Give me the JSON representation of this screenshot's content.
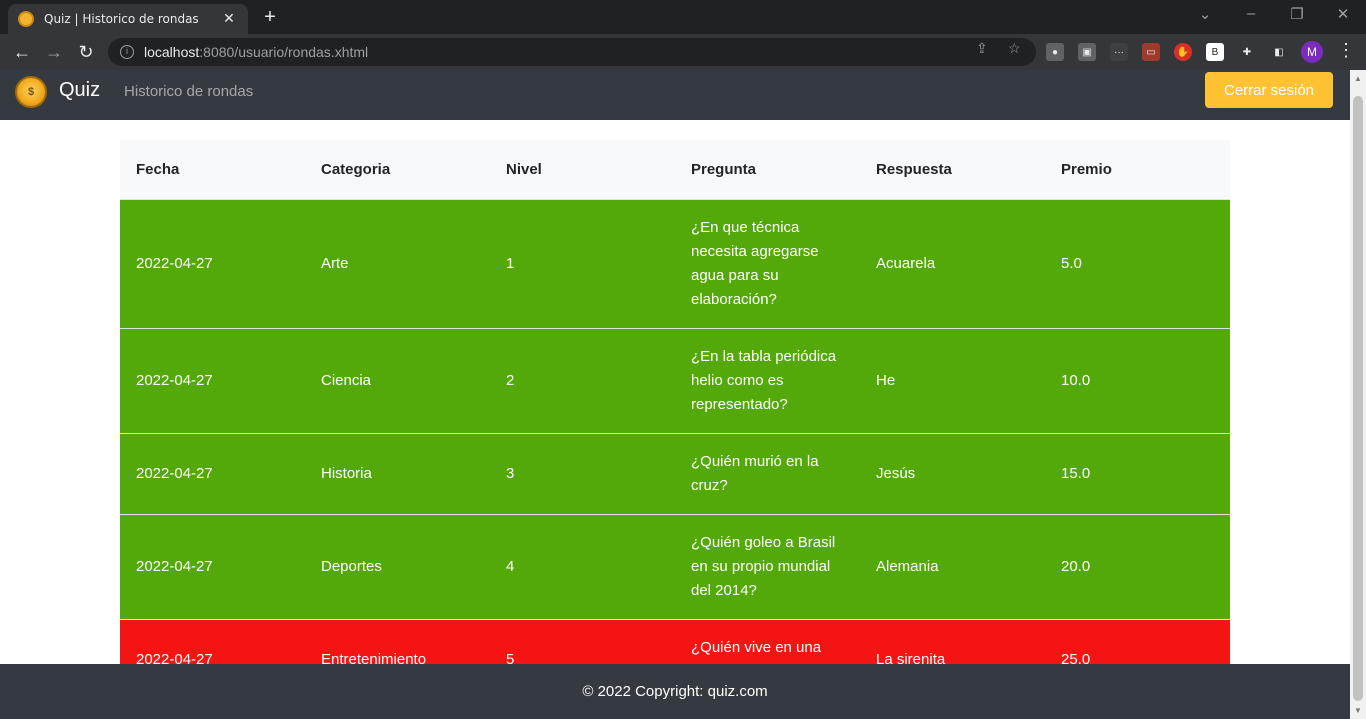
{
  "browser": {
    "tab_title": "Quiz | Historico de rondas",
    "url_host": "localhost",
    "url_rest": ":8080/usuario/rondas.xhtml",
    "profile_initial": "M"
  },
  "navbar": {
    "brand": "Quiz",
    "link": "Historico de rondas",
    "logout_label": "Cerrar sesión"
  },
  "table": {
    "headers": [
      "Fecha",
      "Categoria",
      "Nivel",
      "Pregunta",
      "Respuesta",
      "Premio"
    ],
    "rows": [
      {
        "fecha": "2022-04-27",
        "categoria": "Arte",
        "nivel": "1",
        "pregunta": "¿En que técnica necesita agregarse agua para su elaboración?",
        "respuesta": "Acuarela",
        "premio": "5.0",
        "status": "correct"
      },
      {
        "fecha": "2022-04-27",
        "categoria": "Ciencia",
        "nivel": "2",
        "pregunta": "¿En la tabla periódica helio como es representado?",
        "respuesta": "He",
        "premio": "10.0",
        "status": "correct"
      },
      {
        "fecha": "2022-04-27",
        "categoria": "Historia",
        "nivel": "3",
        "pregunta": "¿Quién murió en la cruz?",
        "respuesta": "Jesús",
        "premio": "15.0",
        "status": "correct"
      },
      {
        "fecha": "2022-04-27",
        "categoria": "Deportes",
        "nivel": "4",
        "pregunta": "¿Quién goleo a Brasil en su propio mundial del 2014?",
        "respuesta": "Alemania",
        "premio": "20.0",
        "status": "correct"
      },
      {
        "fecha": "2022-04-27",
        "categoria": "Entretenimiento",
        "nivel": "5",
        "pregunta": "¿Quién vive en una piña debajo del mar?",
        "respuesta": "La sirenita",
        "premio": "25.0",
        "status": "incorrect"
      }
    ]
  },
  "colors": {
    "correct": "#54a90a",
    "incorrect": "#f41414"
  },
  "footer": {
    "text": "© 2022 Copyright: quiz.com"
  }
}
